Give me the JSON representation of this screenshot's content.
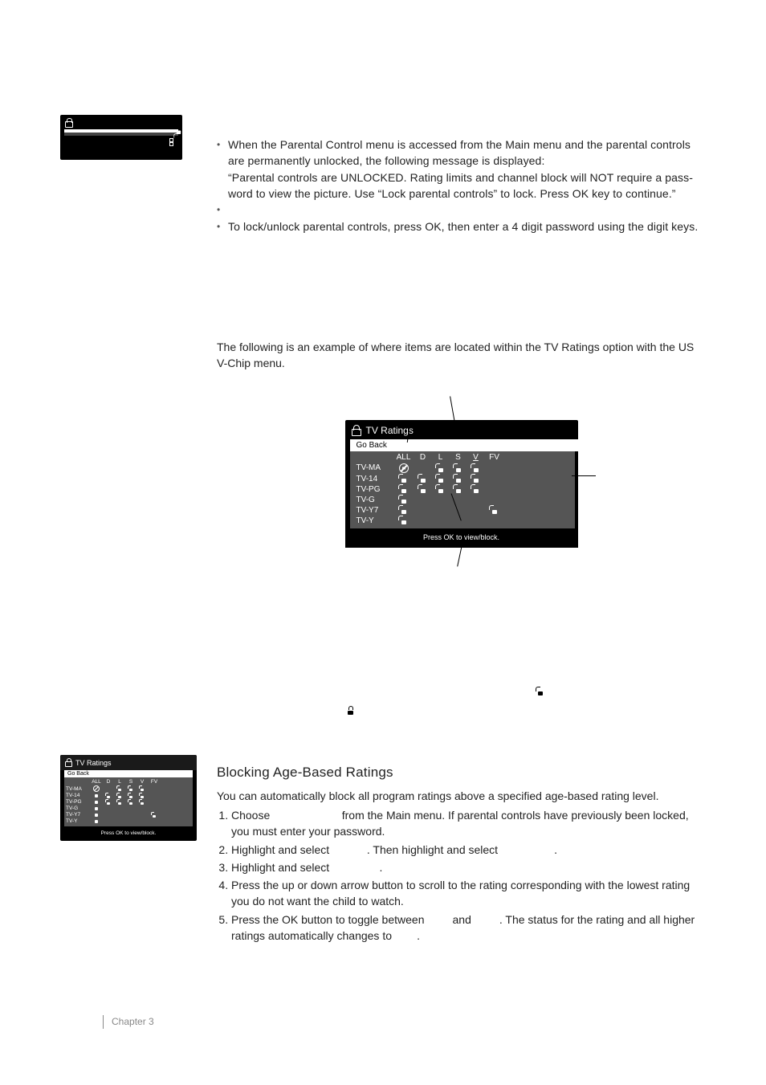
{
  "sidebar_menu": {
    "title": "",
    "go_back": "",
    "lock_row": "",
    "channel_row": "",
    "help": ""
  },
  "bullets": {
    "b1": "When the Parental Control menu is accessed from the Main menu and the parental controls are permanently unlocked, the following message is displayed:",
    "b1_quote": "“Parental controls are UNLOCKED. Rating limits and channel block will NOT require a pass­word to view the picture. Use “Lock parental controls” to lock. Press OK key to continue.”",
    "b2": "",
    "b3": "To lock/unlock parental controls, press OK, then enter a 4 digit password using the digit keys."
  },
  "section_intro": "The following is an example of where items are located within the TV Ratings option with the US V-Chip menu.",
  "tv_ratings_dialog": {
    "title": "TV Ratings",
    "go_back": "Go Back",
    "headers": {
      "all": "ALL",
      "d": "D",
      "l": "L",
      "s": "S",
      "v": "V",
      "fv": "FV"
    },
    "rows": [
      "TV-MA",
      "TV-14",
      "TV-PG",
      "TV-G",
      "TV-Y7",
      "TV-Y"
    ],
    "help": "Press OK to view/block."
  },
  "sidebar_tv": {
    "title": "TV Ratings",
    "go_back": "Go Back",
    "headers": {
      "all": "ALL",
      "d": "D",
      "l": "L",
      "s": "S",
      "v": "V",
      "fv": "FV"
    },
    "rows": [
      "TV-MA",
      "TV-14",
      "TV-PG",
      "TV-G",
      "TV-Y7",
      "TV-Y"
    ],
    "help": "Press OK to view/block."
  },
  "blocking": {
    "heading": "Blocking  Age-Based Ratings",
    "intro": "You can automatically block all program ratings above a specified age-based rating level.",
    "steps": {
      "s1a": "Choose ",
      "s1b": " from the Main menu. If parental controls have previously been locked, you must enter your password.",
      "s2a": "Highlight and select ",
      "s2mid": ". Then highlight and select ",
      "s2b": ".",
      "s3a": "Highlight and select ",
      "s3b": ".",
      "s4": "Press the up or down arrow button to scroll to the rating corresponding with the lowest rating you do not want the child to watch.",
      "s5a": "Press the OK button to toggle between ",
      "s5mid": " and ",
      "s5b": ". The status for the rating and all higher ratings automatically changes to ",
      "s5c": "."
    }
  },
  "footer": "Chapter 3"
}
